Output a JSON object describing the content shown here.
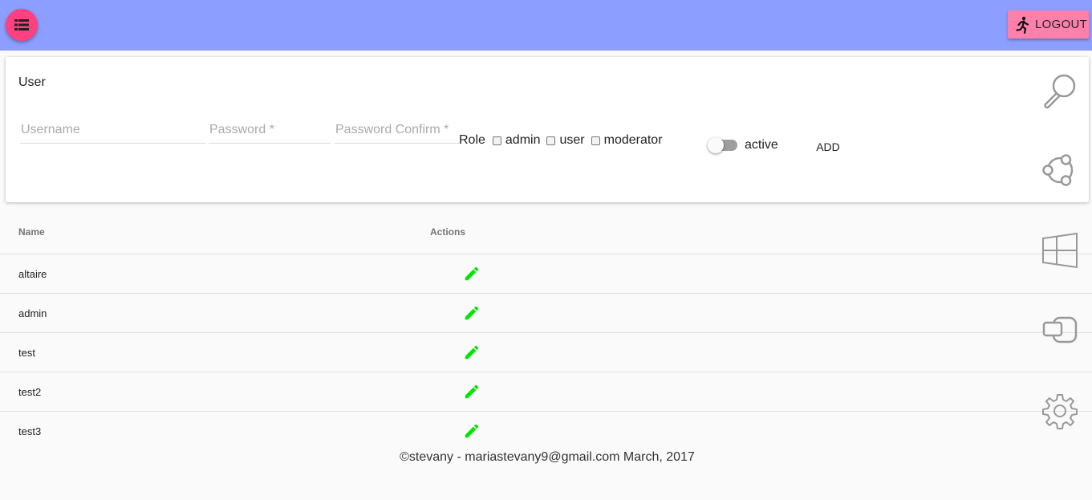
{
  "header": {
    "menu_icon": "list-icon",
    "logout": {
      "label": "LOGOUT",
      "icon": "running-person-icon"
    },
    "colors": {
      "appbar": "#8c9eff",
      "fab": "#ff4081",
      "logout_bg": "#ff80ab"
    }
  },
  "form": {
    "title": "User",
    "username_placeholder": "Username",
    "password_placeholder": "Password *",
    "password_confirm_placeholder": "Password Confirm *",
    "role_label": "Role",
    "roles": [
      "admin",
      "user",
      "moderator"
    ],
    "active_label": "active",
    "active": false,
    "add_label": "ADD"
  },
  "table": {
    "headers": {
      "name": "Name",
      "actions": "Actions"
    },
    "rows": [
      {
        "name": "altaire"
      },
      {
        "name": "admin"
      },
      {
        "name": "test"
      },
      {
        "name": "test2"
      },
      {
        "name": "test3"
      }
    ],
    "edit_icon": "pencil-icon",
    "edit_color": "#00e600"
  },
  "side_nav": [
    "search-icon",
    "ubuntu-icon",
    "windows-icon",
    "devices-icon",
    "gear-icon"
  ],
  "footer": {
    "text": "©stevany - mariastevany9@gmail.com March, 2017"
  }
}
